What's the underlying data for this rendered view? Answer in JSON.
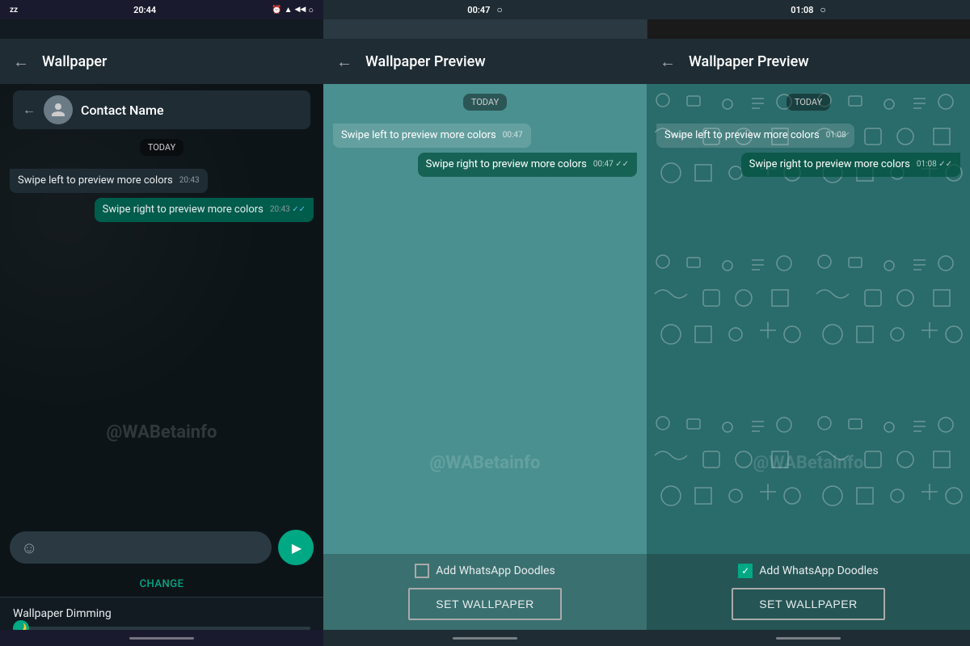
{
  "panels": {
    "left": {
      "statusBar": {
        "time": "20:44",
        "leftIcons": "zz",
        "rightIcons": "⏰ ▲ ◀ ◀ ○"
      },
      "appBar": {
        "title": "Wallpaper",
        "backLabel": "←"
      },
      "contactName": "Contact Name",
      "dateChip": "TODAY",
      "messages": [
        {
          "type": "received",
          "text": "Swipe left to preview more colors",
          "time": "20:43"
        },
        {
          "type": "sent",
          "text": "Swipe right to preview more colors",
          "time": "20:43",
          "ticks": "✓✓"
        }
      ],
      "changeLabel": "CHANGE",
      "dimmingLabel": "Wallpaper Dimming"
    },
    "center": {
      "statusBar": {
        "time": "00:47"
      },
      "appBar": {
        "title": "Wallpaper Preview",
        "backLabel": "←"
      },
      "dateChip": "TODAY",
      "messages": [
        {
          "type": "received",
          "text": "Swipe left to preview more colors",
          "time": "00:47"
        },
        {
          "type": "sent",
          "text": "Swipe right to preview more colors",
          "time": "00:47",
          "ticks": "✓✓"
        }
      ],
      "addDoodles": "Add WhatsApp Doodles",
      "setWallpaper": "SET WALLPAPER",
      "doodlesChecked": false
    },
    "right": {
      "statusBar": {
        "time": "01:08"
      },
      "appBar": {
        "title": "Wallpaper Preview",
        "backLabel": "←"
      },
      "dateChip": "TODAY",
      "messages": [
        {
          "type": "received",
          "text": "Swipe left to preview more colors",
          "time": "01:08"
        },
        {
          "type": "sent",
          "text": "Swipe right to preview more colors",
          "time": "01:08",
          "ticks": "✓✓"
        }
      ],
      "addDoodles": "Add WhatsApp Doodles",
      "setWallpaper": "SET WALLPAPER",
      "doodlesChecked": true
    }
  },
  "watermark": "@WABetainfo",
  "colors": {
    "teal": "#00a884",
    "darkBg": "#111b21",
    "chatBg1": "#0d1418",
    "chatBg2": "#3d8b8b",
    "chatBg3": "#2a6b6b",
    "appBar": "#1f2c34"
  }
}
